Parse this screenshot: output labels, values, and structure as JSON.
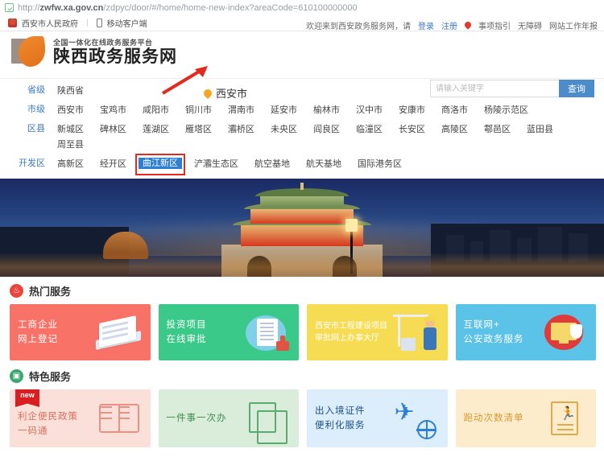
{
  "browser": {
    "url_prefix": "http://",
    "url_domain": "zwfw.xa.gov.cn",
    "url_path": "/zdpyc/door/#/home/home-new-index?areaCode=610100000000",
    "shield_icon": "security-shield-icon"
  },
  "govbar": {
    "gov_site": "西安市人民政府",
    "separator": "|",
    "mobile_client": "移动客户端"
  },
  "welcome": {
    "greeting": "欢迎来到西安政务服务网，请",
    "login": "登录",
    "register": "注册",
    "pin_icon": "location-pin-icon",
    "guide": "事项指引",
    "accessibility": "无障碍",
    "annual_report": "网站工作年报"
  },
  "header": {
    "platform_line": "全国一体化在线政务服务平台",
    "site_title": "陕西政务服务网",
    "location_icon": "location-pin-icon",
    "location": "西安市",
    "annotation_arrow": "red-arrow-annotation"
  },
  "search": {
    "placeholder": "请输入关键字",
    "value": "",
    "button": "查询"
  },
  "region": {
    "rows": [
      {
        "label": "省级",
        "items": [
          "陕西省"
        ]
      },
      {
        "label": "市级",
        "items": [
          "西安市",
          "宝鸡市",
          "咸阳市",
          "铜川市",
          "渭南市",
          "延安市",
          "榆林市",
          "汉中市",
          "安康市",
          "商洛市",
          "杨陵示范区"
        ]
      },
      {
        "label": "区县",
        "items": [
          "新城区",
          "碑林区",
          "莲湖区",
          "雁塔区",
          "灞桥区",
          "未央区",
          "阎良区",
          "临潼区",
          "长安区",
          "高陵区",
          "鄠邑区",
          "蓝田县",
          "周至县"
        ]
      },
      {
        "label": "开发区",
        "items": [
          "高新区",
          "经开区",
          "曲江新区",
          "浐灞生态区",
          "航空基地",
          "航天基地",
          "国际港务区"
        ]
      }
    ],
    "selected": "曲江新区",
    "highlight_color": "#e02b20",
    "selected_color": "#2f7fd0"
  },
  "banner": {
    "alt": "西安钟楼夜景"
  },
  "hot_services": {
    "icon": "flame-icon",
    "title": "热门服务",
    "cards": [
      {
        "text": "工商企业\n网上登记",
        "color": "#f97268",
        "art": "laptop-icon"
      },
      {
        "text": "投资项目\n在线审批",
        "color": "#3bc98a",
        "art": "document-stamp-icon"
      },
      {
        "text": "西安市工程建设项目\n审批网上办事大厅",
        "color": "#f5dc53",
        "art": "construction-icon"
      },
      {
        "text": "互联网+\n公安政务服务",
        "color": "#5bc3e8",
        "art": "cyber-security-icon"
      }
    ]
  },
  "featured_services": {
    "icon": "grid-icon",
    "title": "特色服务",
    "cards": [
      {
        "text": "利企便民政策\n一码通",
        "color": "#fae0d8",
        "text_color": "#d9705f",
        "badge": "new",
        "art": "open-book-icon"
      },
      {
        "text": "一件事一次办",
        "color": "#d9edda",
        "text_color": "#3f8f4e",
        "badge": "",
        "art": "documents-icon"
      },
      {
        "text": "出入境证件\n便利化服务",
        "color": "#dceefb",
        "text_color": "#1b4f8a",
        "badge": "",
        "art": "airplane-globe-icon"
      },
      {
        "text": "跑动次数清单",
        "color": "#fdeccb",
        "text_color": "#d79a33",
        "badge": "",
        "art": "runner-list-icon"
      }
    ]
  }
}
